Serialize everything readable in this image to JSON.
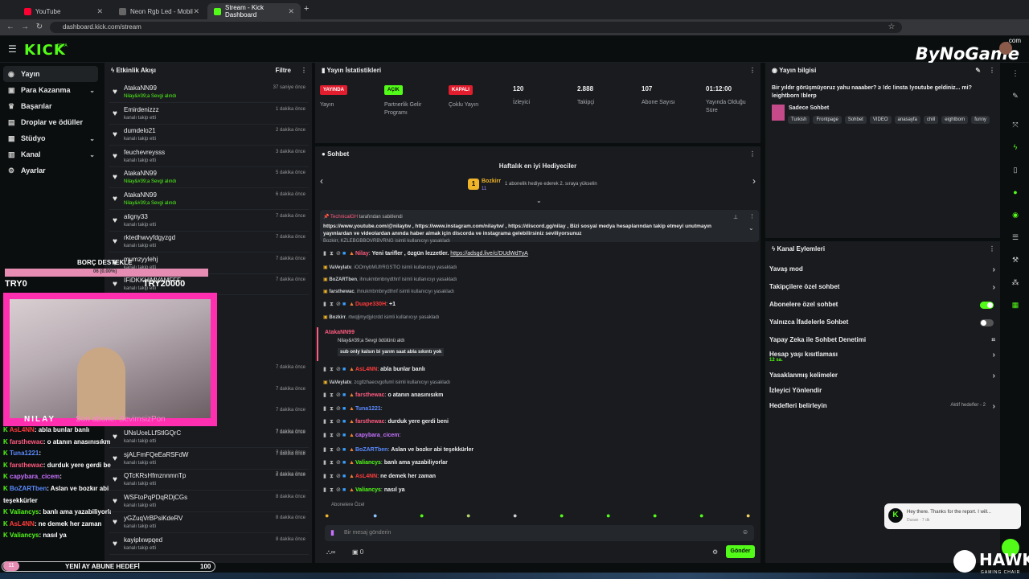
{
  "browser": {
    "tabs": [
      {
        "label": "YouTube",
        "favcolor": "#ff0033"
      },
      {
        "label": "Neon Rgb Led - Mobil Kontrol",
        "favcolor": "#666666"
      },
      {
        "label": "Stream - Kick Dashboard",
        "favcolor": "#53fc18"
      }
    ],
    "url": "dashboard.kick.com/stream"
  },
  "header": {
    "logo": "KICK",
    "beta": "BETA",
    "watermark": "ByNoGame",
    "watermark_sub": ".com"
  },
  "sidebar": {
    "items": [
      {
        "label": "Yayın",
        "icon": "broadcast-icon"
      },
      {
        "label": "Para Kazanma",
        "icon": "money-icon"
      },
      {
        "label": "Başarılar",
        "icon": "trophy-icon"
      },
      {
        "label": "Droplar ve ödüller",
        "icon": "gift-icon"
      },
      {
        "label": "Stüdyo",
        "icon": "studio-icon"
      },
      {
        "label": "Kanal",
        "icon": "channel-icon"
      },
      {
        "label": "Ayarlar",
        "icon": "gear-icon"
      }
    ]
  },
  "activity": {
    "title": "Etkinlik Akışı",
    "filter": "Filtre",
    "events": [
      {
        "name": "AtakaNN99",
        "sub": "Nilay&#39;a Sevgi alındı",
        "gift": true,
        "time": "37 saniye önce"
      },
      {
        "name": "Emirdenizzz",
        "sub": "kanalı takip etti",
        "gift": false,
        "time": "1 dakika önce"
      },
      {
        "name": "dumdelo21",
        "sub": "kanalı takip etti",
        "gift": false,
        "time": "2 dakika önce"
      },
      {
        "name": "feuchevreysss",
        "sub": "kanalı takip etti",
        "gift": false,
        "time": "3 dakika önce"
      },
      {
        "name": "AtakaNN99",
        "sub": "Nilay&#39;a Sevgi alındı",
        "gift": true,
        "time": "5 dakika önce"
      },
      {
        "name": "AtakaNN99",
        "sub": "Nilay&#39;a Sevgi alındı",
        "gift": true,
        "time": "6 dakika önce"
      },
      {
        "name": "aligny33",
        "sub": "kanalı takip etti",
        "gift": false,
        "time": "7 dakika önce"
      },
      {
        "name": "rktedhwvyfdgyzgd",
        "sub": "kanalı takip etti",
        "gift": false,
        "time": "7 dakika önce"
      },
      {
        "name": "mumzyylehj",
        "sub": "kanalı takip etti",
        "gift": false,
        "time": "7 dakika önce"
      },
      {
        "name": "IFiDKKHjMVAMFFF",
        "sub": "kanalı takip etti",
        "gift": false,
        "time": "7 dakika önce"
      }
    ],
    "events_lower": [
      {
        "name": "UNsUceLLfStlGQrC",
        "sub": "kanalı takip etti",
        "time": "7 dakika önce"
      },
      {
        "name": "sjALFmFQeEaRSFdW",
        "sub": "kanalı takip etti",
        "time": "7 dakika önce"
      },
      {
        "name": "QTcKRsHfmznnmnTp",
        "sub": "kanalı takip etti",
        "time": "8 dakika önce"
      },
      {
        "name": "WSFtoPqPDqRDjCGs",
        "sub": "kanalı takip etti",
        "time": "8 dakika önce"
      },
      {
        "name": "yGZuqVrBPsiKdeRV",
        "sub": "kanalı takip etti",
        "time": "8 dakika önce"
      },
      {
        "name": "kayiplxwpqed",
        "sub": "kanalı takip etti",
        "time": "8 dakika önce"
      }
    ],
    "hidden_times": [
      "7 dakika önce",
      "7 dakika önce",
      "7 dakika önce",
      "7 dakika önce",
      "7 dakika önce",
      "7 dakika önce"
    ]
  },
  "stats": {
    "title": "Yayın İstatistikleri",
    "items": [
      {
        "badge": "YAYINDA",
        "label": "Yayın",
        "color": "#e11d2e"
      },
      {
        "badge": "AÇIK",
        "label": "Partnerlik Gelir Programı",
        "color": "#53fc18"
      },
      {
        "badge": "KAPALI",
        "label": "Çoklu Yayın",
        "color": "#e11d2e"
      },
      {
        "value": "120",
        "label": "İzleyici"
      },
      {
        "value": "2.888",
        "label": "Takipçi"
      },
      {
        "value": "107",
        "label": "Abone Sayısı"
      },
      {
        "value": "01:12:00",
        "label": "Yayında Olduğu Süre"
      }
    ]
  },
  "chat": {
    "title": "Sohbet",
    "gifters_title": "Haftalık en iyi Hediyeciler",
    "top_gifter": "Bozkirr",
    "top_gifter_rank": "1",
    "top_gifter_count": "11",
    "gifter_hint": "1 abonelik hediye ederek 2. sıraya yükselin",
    "pinned_by_user": "TechnicalGH",
    "pinned_by": "tarafından sabitlendi",
    "pinned_text": "https://www.youtube.com/@nilaytw , https://www.instagram.com/nilaytw/ , https://discord.gg/nilay , Bizi sosyal medya hesaplarından takip etmeyi unutmayın yayınlardan ve videolardan anında haber almak için discorda ve instagrama gelebilirsiniz seviliyorsunuz",
    "hidden_sys": "Bozkirr, KZLEBGBBOVRBVRNG isimli kullanıcıyı yasakladı",
    "messages": [
      {
        "type": "msg",
        "user": "Nilay",
        "color": "#ff5b7f",
        "text": "Yeni tarifler ,  özgün lezzetler.",
        "link": "https://adsgd.live/c/DUdWdTyA"
      },
      {
        "type": "sys",
        "actor": "VaVeylatv",
        "text": ", iOOmybMUfrRGSTlO isimli kullanıcıyı yasakladı"
      },
      {
        "type": "sys",
        "actor": "BoZARTben",
        "text": ", ihnukmbmbnydthnf isimli kullanıcıyı yasakladı"
      },
      {
        "type": "sys",
        "actor": "farsthewac",
        "text": ", ihnukmbmbnydthnf isimli kullanıcıyı yasakladı"
      },
      {
        "type": "msg",
        "user": "Duape330H",
        "color": "#ff3b3b",
        "text": "+1",
        "link": ""
      },
      {
        "type": "sys",
        "actor": "Bozkirr",
        "text": ", rtwqljmydjylcrdd isimli kullanıcıyı yasakladı"
      }
    ],
    "gift_user": "AtakaNN99",
    "gift_line": "Nilay&#39;a Sevgi ödülünü aldı",
    "gift_comment": "sub only kalsın bi yarım saat abla sıkıntı yok",
    "messages2": [
      {
        "type": "msg",
        "user": "AsL4NN",
        "color": "#ff3b3b",
        "text": "abla bunlar banlı"
      },
      {
        "type": "sys",
        "actor": "VaVeylatv",
        "text": ", zcgtlzhaecvgofuml isimli kullanıcıyı yasakladı"
      },
      {
        "type": "msg",
        "user": "farsthewac",
        "color": "#ff5b7f",
        "text": "o atanın anasınısıkm"
      },
      {
        "type": "msg",
        "user": "Tuna1221",
        "color": "#5b8bff",
        "text": ""
      },
      {
        "type": "msg",
        "user": "farsthewac",
        "color": "#ff5b7f",
        "text": "durduk yere gerdi beni"
      },
      {
        "type": "msg",
        "user": "capybara_cicem",
        "color": "#c772ff",
        "text": ""
      },
      {
        "type": "msg",
        "user": "BoZARTben",
        "color": "#5b8bff",
        "text": "Aslan ve bozkır abi teşekkürler"
      },
      {
        "type": "msg",
        "user": "Valiancys",
        "color": "#53fc18",
        "text": "banlı ama yazabiliyorlar"
      },
      {
        "type": "msg",
        "user": "AsL4NN",
        "color": "#ff3b3b",
        "text": "ne demek her zaman"
      },
      {
        "type": "msg",
        "user": "Valiancys",
        "color": "#53fc18",
        "text": "nasıl ya"
      }
    ],
    "emote_section": "Abonelere Özel",
    "input_placeholder": "Bir mesaj gönderin",
    "send": "Gönder",
    "counter": "0"
  },
  "info": {
    "title": "Yayın bilgisi",
    "stream_title": "Bir yıldır görüşmüyoruz yahu naaaber? ≥ !dc !insta !youtube geldiniz... mi? leightborn !blerp",
    "category": "Sadece Sohbet",
    "tags": [
      "Turkish",
      "Frontpage",
      "Sohbet",
      "VIDEO",
      "anasayfa",
      "chill",
      "eightborn",
      "funny"
    ]
  },
  "actions": {
    "title": "Kanal Eylemleri",
    "items": [
      {
        "label": "Yavaş mod",
        "kind": "arrow"
      },
      {
        "label": "Takipçilere özel sohbet",
        "kind": "arrow"
      },
      {
        "label": "Abonelere özel sohbet",
        "kind": "on"
      },
      {
        "label": "Yalnızca İfadelerle Sohbet",
        "kind": "off"
      },
      {
        "label": "Yapay Zeka ile Sohbet Denetimi",
        "kind": "chart"
      },
      {
        "label": "Hesap yaşı kısıtlaması",
        "sub": "12 sa.",
        "kind": "arrow"
      },
      {
        "label": "Yasaklanmış kelimeler",
        "kind": "arrow"
      },
      {
        "label": "İzleyici Yönlendir",
        "kind": "none"
      },
      {
        "label": "Hedefleri belirleyin",
        "extra": "Aktif hedefler - 2",
        "kind": "arrow"
      }
    ]
  },
  "toast": {
    "text": "Hey there. Thanks for the report. I will...",
    "from": "Dusan · 7 dk"
  },
  "overlay": {
    "goal_title": "BORÇ DESTEKLE",
    "goal_progress": "06 (0.00%)",
    "goal_left": "TRY0",
    "goal_right": "TRY20000",
    "streamer": "NILAY",
    "last_sub": "Son abone: SevimsizPon",
    "chat": [
      {
        "user": "AsL4NN",
        "text": ": abla bunlar banlı",
        "color": "#ff3b3b"
      },
      {
        "user": "farsthewac",
        "text": ": o atanın anasınısıkm",
        "color": "#ff5b7f"
      },
      {
        "user": "Tuna1221",
        "text": ":",
        "color": "#5b8bff"
      },
      {
        "user": "farsthewac",
        "text": ": durduk yere gerdi beni",
        "color": "#ff5b7f"
      },
      {
        "user": "capybara_cicem",
        "text": ":",
        "color": "#c772ff"
      },
      {
        "user": "BoZARTben",
        "text": ": Aslan ve bozkır abi",
        "color": "#5b8bff"
      },
      {
        "user": "teşekkürler",
        "text": "",
        "color": "#ffffff"
      },
      {
        "user": "Valiancys",
        "text": ": banlı ama yazabiliyorlar",
        "color": "#53fc18"
      },
      {
        "user": "AsL4NN",
        "text": ": ne demek her zaman",
        "color": "#ff3b3b"
      },
      {
        "user": "Valiancys",
        "text": ": nasıl ya",
        "color": "#53fc18"
      }
    ],
    "goal_bar": "YENİ AY ABUNE HEDEFİ",
    "goal_bar_value": "100",
    "bubble_count": "11",
    "hawk": "HAWK",
    "hawk_sub": "GAMING CHAIR"
  }
}
